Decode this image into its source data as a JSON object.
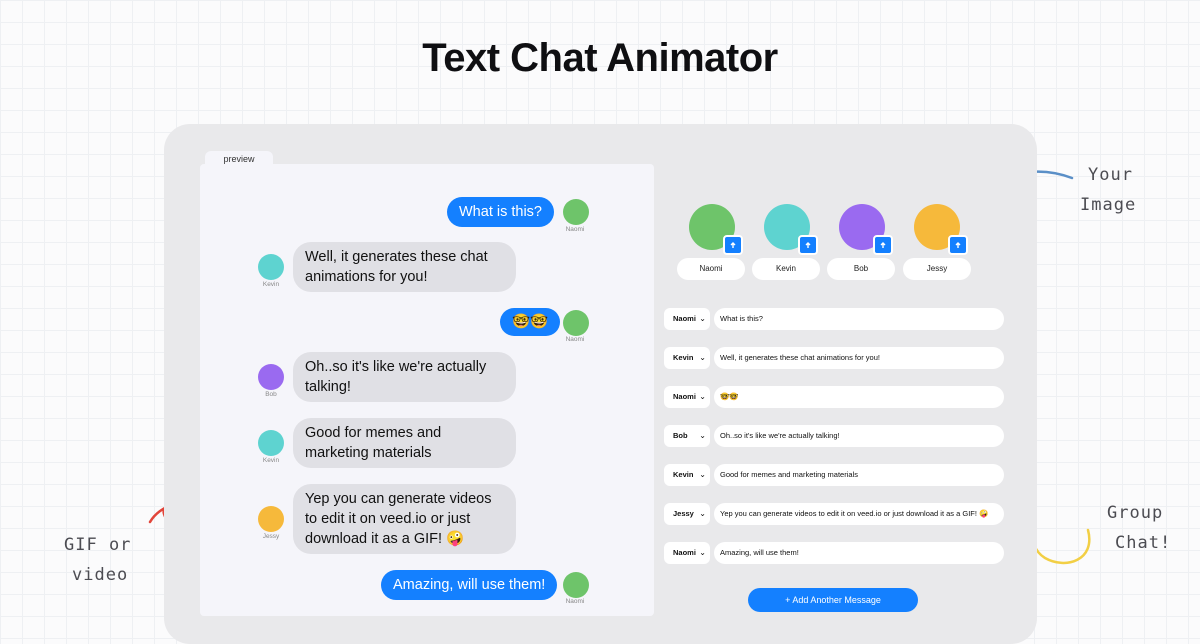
{
  "title": "Text Chat Animator",
  "preview": {
    "tab_label": "preview",
    "messages": [
      {
        "sender": "Naomi",
        "side": "right",
        "text": "What is this?"
      },
      {
        "sender": "Kevin",
        "side": "left",
        "text": "Well, it generates these chat animations for you!"
      },
      {
        "sender": "Naomi",
        "side": "right",
        "text": "🤓🤓"
      },
      {
        "sender": "Bob",
        "side": "left",
        "text": "Oh..so it's like we're actually talking!"
      },
      {
        "sender": "Kevin",
        "side": "left",
        "text": "Good for memes and marketing materials"
      },
      {
        "sender": "Jessy",
        "side": "left",
        "text": "Yep you can generate videos to edit it on veed.io or just download it as a GIF! 🤪"
      },
      {
        "sender": "Naomi",
        "side": "right",
        "text": "Amazing, will use them!"
      }
    ]
  },
  "people": [
    {
      "name": "Naomi",
      "bg_color": "#6ec46a"
    },
    {
      "name": "Kevin",
      "bg_color": "#5ed3d0"
    },
    {
      "name": "Bob",
      "bg_color": "#9a6af0"
    },
    {
      "name": "Jessy",
      "bg_color": "#f6b93b"
    }
  ],
  "editor_rows": [
    {
      "sender": "Naomi",
      "text": "What is this?"
    },
    {
      "sender": "Kevin",
      "text": "Well, it generates these chat animations for you!"
    },
    {
      "sender": "Naomi",
      "text": "🤓🤓"
    },
    {
      "sender": "Bob",
      "text": "Oh..so it's like we're actually talking!"
    },
    {
      "sender": "Kevin",
      "text": "Good for memes and marketing materials"
    },
    {
      "sender": "Jessy",
      "text": "Yep you can generate videos to edit it on veed.io or just download it as a GIF! 🤪"
    },
    {
      "sender": "Naomi",
      "text": "Amazing, will use them!"
    }
  ],
  "add_button_label": "+ Add Another Message",
  "annotations": {
    "your_image_line1": "Your",
    "your_image_line2": "Image",
    "group_chat_line1": "Group",
    "group_chat_line2": "Chat!",
    "gif_line1": "GIF or",
    "gif_line2": "video"
  },
  "colors": {
    "accent": "#1480ff",
    "arrow_blue": "#5a8fc7",
    "arrow_red": "#e2453a",
    "arrow_yellow": "#f2cf45"
  }
}
